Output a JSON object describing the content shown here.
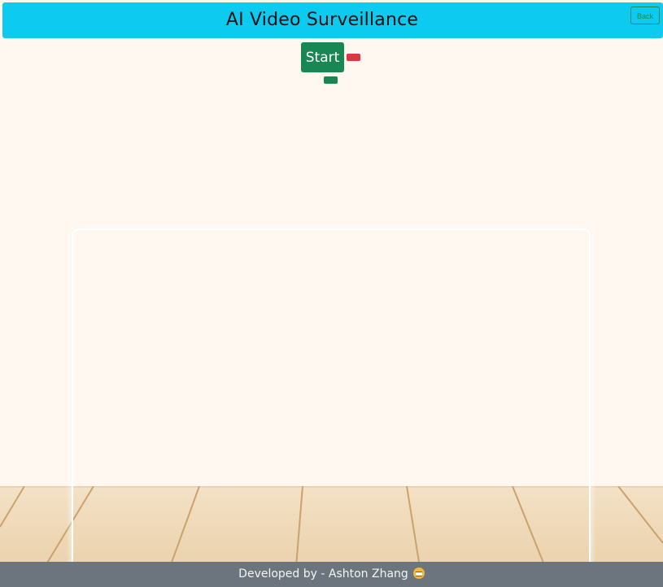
{
  "header": {
    "title": "AI Video Surveillance",
    "back_label": "Back"
  },
  "controls": {
    "start_label": "Start",
    "stop_label": "",
    "secondary_label": ""
  },
  "footer": {
    "text": "Developed by - Ashton Zhang",
    "emoji_icon": "grimacing-face-icon"
  },
  "colors": {
    "header_bg": "#0dcaf0",
    "start": "#198754",
    "stop": "#dc3545",
    "footer_bg": "#6c757d",
    "page_bg": "#fef8f0"
  }
}
